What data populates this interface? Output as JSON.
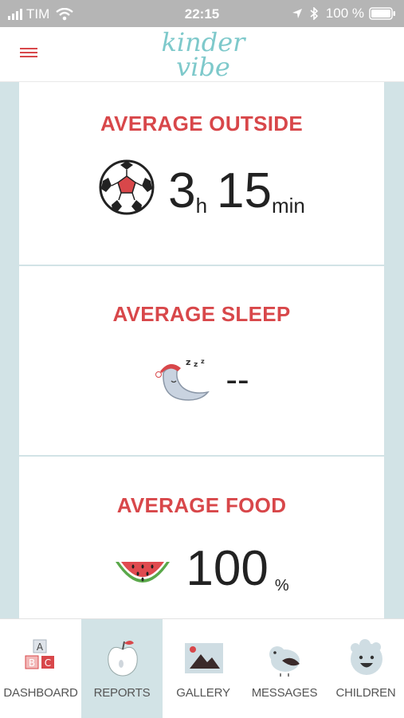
{
  "status_bar": {
    "carrier": "TIM",
    "time": "22:15",
    "battery": "100 %"
  },
  "header": {
    "logo_line1": "kinder",
    "logo_line2": "vibe",
    "menu_icon": "hamburger-icon"
  },
  "cards": [
    {
      "title": "AVERAGE OUTSIDE",
      "icon": "soccer-ball-icon",
      "hours": "3",
      "hours_unit": "h",
      "minutes": "15",
      "minutes_unit": "min"
    },
    {
      "title": "AVERAGE SLEEP",
      "icon": "sleeping-moon-icon",
      "value": "--"
    },
    {
      "title": "AVERAGE FOOD",
      "icon": "watermelon-icon",
      "value": "100",
      "unit": "%"
    }
  ],
  "tabs": [
    {
      "label": "DASHBOARD",
      "icon": "abc-blocks-icon",
      "active": false
    },
    {
      "label": "REPORTS",
      "icon": "apple-icon",
      "active": true
    },
    {
      "label": "GALLERY",
      "icon": "picture-icon",
      "active": false
    },
    {
      "label": "MESSAGES",
      "icon": "bird-icon",
      "active": false
    },
    {
      "label": "CHILDREN",
      "icon": "child-face-icon",
      "active": false
    }
  ],
  "colors": {
    "accent": "#d8474a",
    "panel_background": "#d2e3e6",
    "logo": "#7ec9cb"
  }
}
